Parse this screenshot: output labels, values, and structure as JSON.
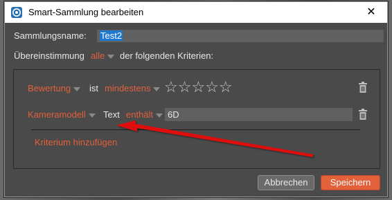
{
  "window": {
    "title": "Smart-Sammlung bearbeiten",
    "close_glyph": "✕"
  },
  "form": {
    "name_label": "Sammlungsname:",
    "name_value": "Test2",
    "match_label": "Übereinstimmung",
    "match_value": "alle",
    "match_suffix": "der folgenden Kriterien:"
  },
  "criteria": [
    {
      "field": "Bewertung",
      "operator_text": "ist",
      "condition": "mindestens",
      "stars_total": 5,
      "stars_filled": 0,
      "stars_glyphs": "☆☆☆☆☆"
    },
    {
      "field": "Kameramodell",
      "operator_text": "Text",
      "condition": "enthält",
      "value": "6D"
    }
  ],
  "add_criterion_label": "Kriterium hinzufügen",
  "buttons": {
    "cancel": "Abbrechen",
    "save": "Speichern"
  },
  "colors": {
    "accent": "#e2603a",
    "dialog_bg": "#4a4a4a",
    "selection": "#1e78d0",
    "annotation_arrow": "#e01010"
  },
  "icons": {
    "app": "aperture-icon",
    "close": "close-icon",
    "delete": "trash-icon",
    "dropdown": "caret-down-icon",
    "star": "star-outline-icon"
  }
}
